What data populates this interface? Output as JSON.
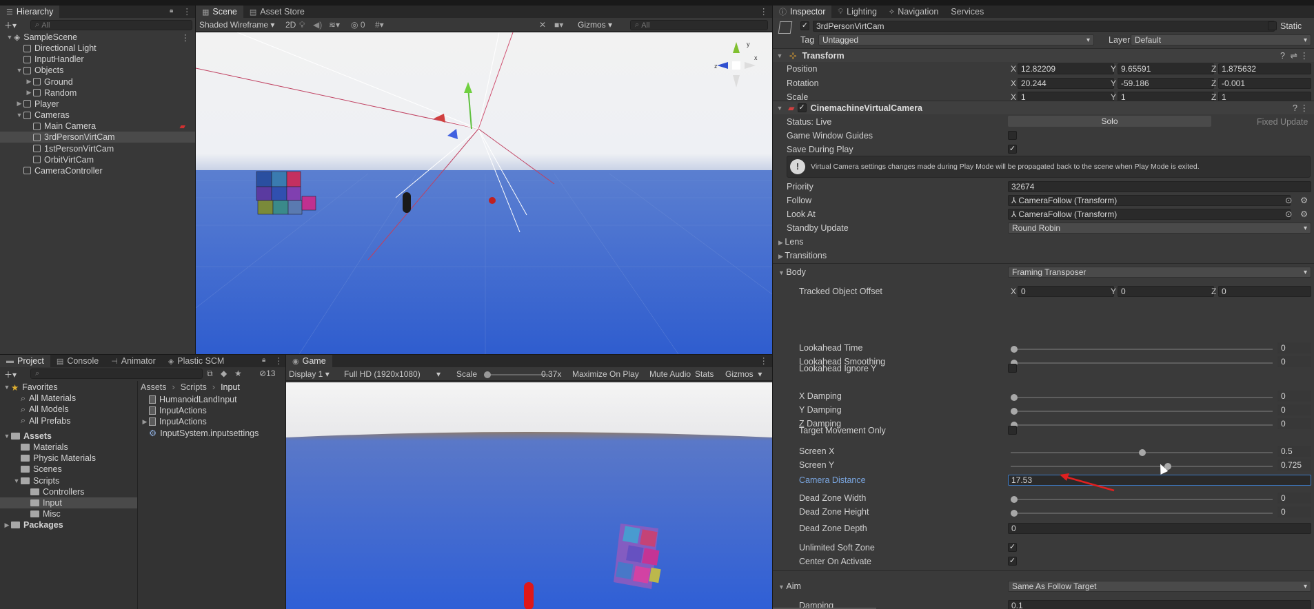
{
  "hierarchy": {
    "tab": "Hierarchy",
    "search_placeholder": "All",
    "items": [
      {
        "label": "SampleScene",
        "kind": "scene",
        "depth": 0,
        "expanded": true
      },
      {
        "label": "Directional Light",
        "kind": "obj",
        "depth": 1
      },
      {
        "label": "InputHandler",
        "kind": "obj",
        "depth": 1
      },
      {
        "label": "Objects",
        "kind": "obj",
        "depth": 1,
        "expanded": true
      },
      {
        "label": "Ground",
        "kind": "obj",
        "depth": 2,
        "collapsed": true
      },
      {
        "label": "Random",
        "kind": "obj",
        "depth": 2,
        "collapsed": true
      },
      {
        "label": "Player",
        "kind": "obj",
        "depth": 1,
        "collapsed": true
      },
      {
        "label": "Cameras",
        "kind": "obj",
        "depth": 1,
        "expanded": true
      },
      {
        "label": "Main Camera",
        "kind": "obj",
        "depth": 2
      },
      {
        "label": "3rdPersonVirtCam",
        "kind": "obj",
        "depth": 2,
        "selected": true
      },
      {
        "label": "1stPersonVirtCam",
        "kind": "obj",
        "depth": 2
      },
      {
        "label": "OrbitVirtCam",
        "kind": "obj",
        "depth": 2
      },
      {
        "label": "CameraController",
        "kind": "obj",
        "depth": 1
      }
    ]
  },
  "scene": {
    "tabs": [
      "Scene",
      "Asset Store"
    ],
    "shading": "Shaded Wireframe",
    "mode2d": "2D",
    "hidden_count": "0",
    "gizmos": "Gizmos",
    "search_placeholder": "All"
  },
  "bottom_tabs": [
    "Project",
    "Console",
    "Animator",
    "Plastic SCM"
  ],
  "project": {
    "count": "13",
    "favorites_label": "Favorites",
    "favorites": [
      "All Materials",
      "All Models",
      "All Prefabs"
    ],
    "assets_label": "Assets",
    "assets": [
      "Materials",
      "Physic Materials",
      "Scenes",
      "Scripts"
    ],
    "scripts": [
      "Controllers",
      "Input",
      "Misc"
    ],
    "packages_label": "Packages",
    "breadcrumb": [
      "Assets",
      "Scripts",
      "Input"
    ],
    "files": [
      "HumanoidLandInput",
      "InputActions",
      "InputActions",
      "InputSystem.inputsettings"
    ]
  },
  "game": {
    "tab": "Game",
    "display": "Display 1",
    "resolution": "Full HD (1920x1080)",
    "scale_label": "Scale",
    "scale_value": "0.37x",
    "maximize": "Maximize On Play",
    "mute": "Mute Audio",
    "stats": "Stats",
    "gizmos": "Gizmos"
  },
  "inspector": {
    "tabs": [
      "Inspector",
      "Lighting",
      "Navigation",
      "Services"
    ],
    "object_name": "3rdPersonVirtCam",
    "static_label": "Static",
    "tag_label": "Tag",
    "tag_value": "Untagged",
    "layer_label": "Layer",
    "layer_value": "Default",
    "transform": {
      "title": "Transform",
      "rows": [
        {
          "label": "Position",
          "x": "12.82209",
          "y": "9.65591",
          "z": "1.875632"
        },
        {
          "label": "Rotation",
          "x": "20.244",
          "y": "-59.186",
          "z": "-0.001"
        },
        {
          "label": "Scale",
          "x": "1",
          "y": "1",
          "z": "1"
        }
      ]
    },
    "vcam": {
      "title": "CinemachineVirtualCamera",
      "status": "Status: Live",
      "solo": "Solo",
      "fixed_update": "Fixed Update",
      "game_window_guides": "Game Window Guides",
      "save_during_play": "Save During Play",
      "info": "Virtual Camera settings changes made during Play Mode will be propagated back to the scene when Play Mode is exited.",
      "priority_label": "Priority",
      "priority": "32674",
      "follow_label": "Follow",
      "follow": "CameraFollow (Transform)",
      "lookat_label": "Look At",
      "lookat": "CameraFollow (Transform)",
      "standby_label": "Standby Update",
      "standby": "Round Robin",
      "lens": "Lens",
      "transitions": "Transitions",
      "body_label": "Body",
      "body": "Framing Transposer",
      "tracked_label": "Tracked Object Offset",
      "tracked": {
        "x": "0",
        "y": "0",
        "z": "0"
      },
      "sliders": [
        {
          "label": "Lookahead Time",
          "value": "0",
          "frac": 0
        },
        {
          "label": "Lookahead Smoothing",
          "value": "0",
          "frac": 0
        },
        {
          "label": "X Damping",
          "value": "0",
          "frac": 0
        },
        {
          "label": "Y Damping",
          "value": "0",
          "frac": 0
        },
        {
          "label": "Z Damping",
          "value": "0",
          "frac": 0
        },
        {
          "label": "Screen X",
          "value": "0.5",
          "frac": 0.5
        },
        {
          "label": "Screen Y",
          "value": "0.725",
          "frac": 0.6
        },
        {
          "label": "Dead Zone Width",
          "value": "0",
          "frac": 0
        },
        {
          "label": "Dead Zone Height",
          "value": "0",
          "frac": 0
        }
      ],
      "lookahead_ignore_y": "Lookahead Ignore Y",
      "target_movement_only": "Target Movement Only",
      "camera_distance_label": "Camera Distance",
      "camera_distance": "17.53",
      "dead_zone_depth_label": "Dead Zone Depth",
      "dead_zone_depth": "0",
      "unlimited_soft_zone": "Unlimited Soft Zone",
      "center_on_activate": "Center On Activate",
      "aim_label": "Aim",
      "aim": "Same As Follow Target",
      "damping_label": "Damping",
      "damping": "0.1"
    }
  },
  "colors": {
    "accent": "#3d7ac4",
    "annotation": "#e02020",
    "panel": "#383838",
    "sky": "#3a62c4"
  }
}
